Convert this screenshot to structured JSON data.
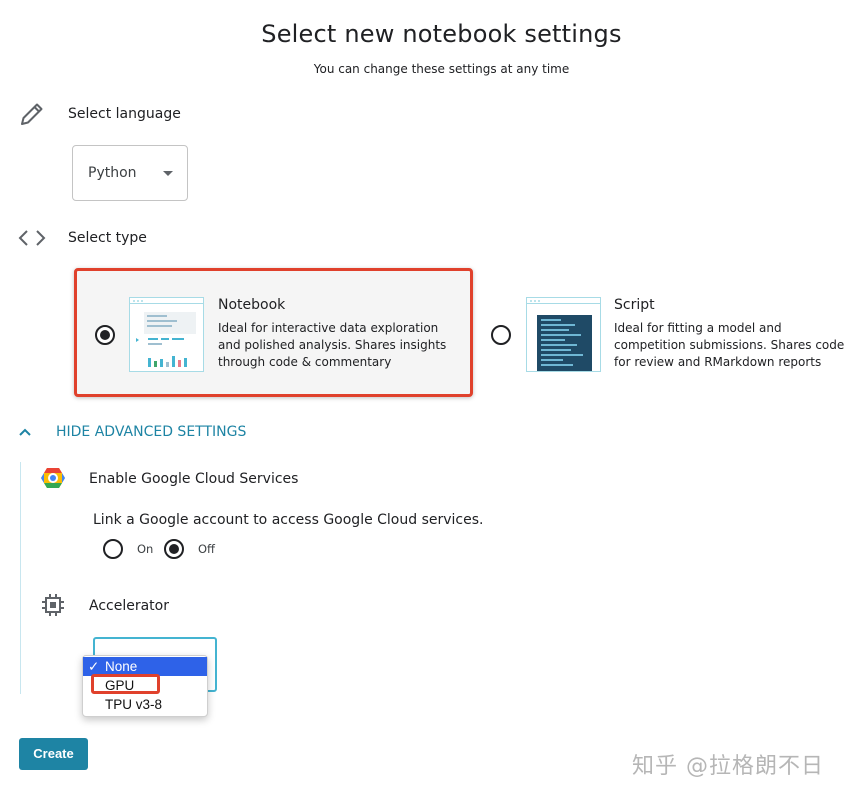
{
  "header": {
    "title": "Select new notebook settings",
    "subtitle": "You can change these settings at any time"
  },
  "language": {
    "label": "Select language",
    "icon": "pencil-icon",
    "selected": "Python"
  },
  "type": {
    "label": "Select type",
    "icon": "code-brackets-icon",
    "options": [
      {
        "title": "Notebook",
        "description": "Ideal for interactive data exploration and polished analysis. Shares insights through code & commentary",
        "description_lines": [
          "Ideal for interactive data exploration",
          "and polished analysis. Shares insights",
          "through code & commentary"
        ],
        "selected": true
      },
      {
        "title": "Script",
        "description": "Ideal for fitting a model and competition submissions. Shares code for review and RMarkdown reports",
        "description_lines": [
          "Ideal for fitting a model and",
          "competition submissions. Shares code",
          "for review and RMarkdown reports"
        ],
        "selected": false
      }
    ]
  },
  "advanced": {
    "toggle_label": "HIDE ADVANCED SETTINGS",
    "cloud": {
      "label": "Enable Google Cloud Services",
      "description": "Link a Google account to access Google Cloud services.",
      "on_label": "On",
      "off_label": "Off",
      "selected": "Off"
    },
    "accelerator": {
      "label": "Accelerator",
      "icon": "chip-icon",
      "options": [
        "None",
        "GPU",
        "TPU v3-8"
      ],
      "selected": "None",
      "check_mark": "✓"
    }
  },
  "actions": {
    "create_label": "Create"
  },
  "watermark": "知乎 @拉格朗不日",
  "colors": {
    "accent": "#1e84a4",
    "highlight": "#e0412c",
    "dropdown_selected": "#2e62e8"
  }
}
